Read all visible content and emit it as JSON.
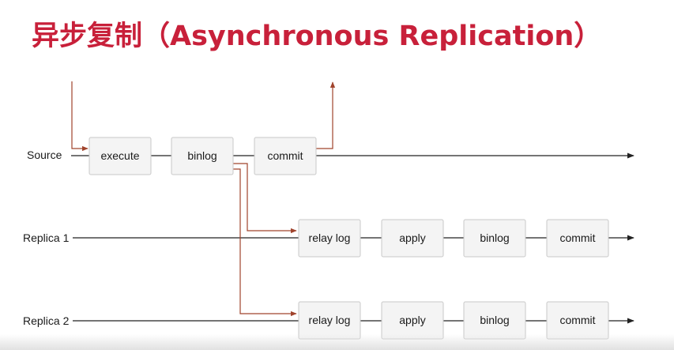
{
  "title": "异步复制（Asynchronous Replication）",
  "colors": {
    "title": "#c8203a",
    "flow_arrow": "#a0432c",
    "timeline": "#222222",
    "box_fill": "#f4f4f4",
    "box_border": "#c9c9c9"
  },
  "lanes": [
    {
      "id": "source",
      "label": "Source",
      "steps": [
        "execute",
        "binlog",
        "commit"
      ]
    },
    {
      "id": "replica1",
      "label": "Replica 1",
      "steps": [
        "relay log",
        "apply",
        "binlog",
        "commit"
      ]
    },
    {
      "id": "replica2",
      "label": "Replica 2",
      "steps": [
        "relay log",
        "apply",
        "binlog",
        "commit"
      ]
    }
  ]
}
